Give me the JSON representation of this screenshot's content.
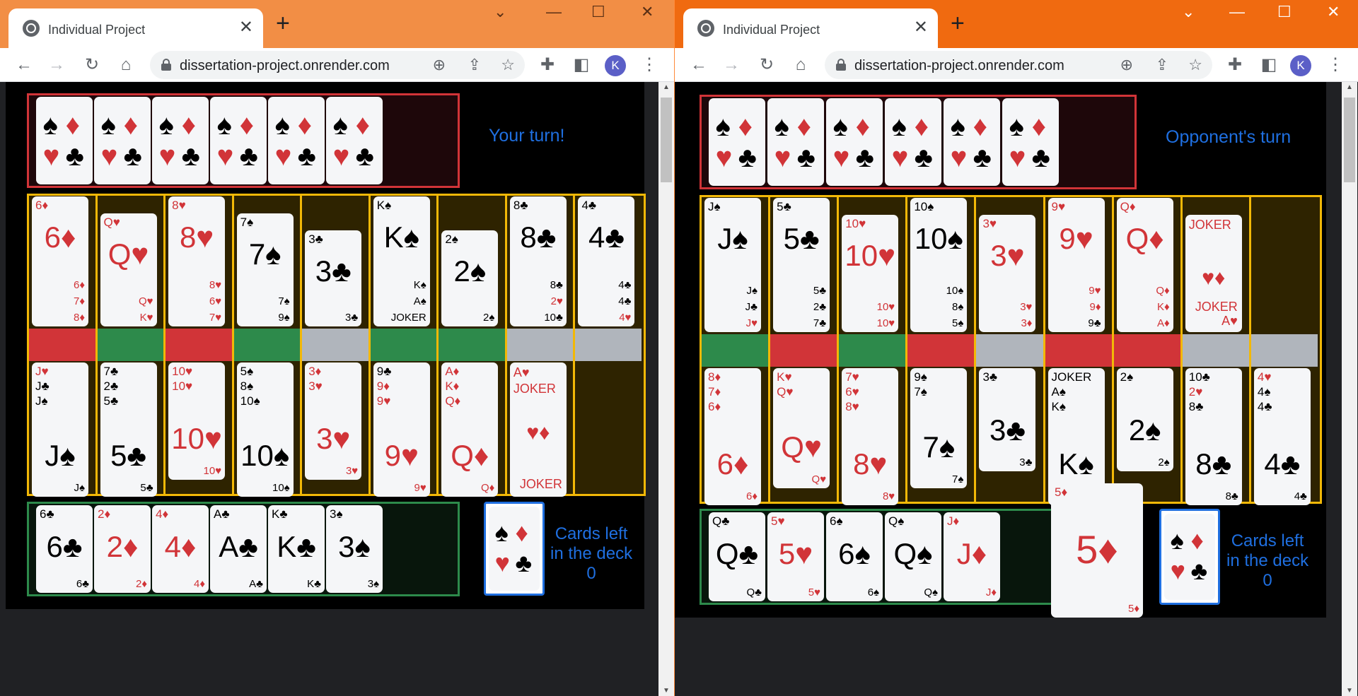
{
  "left": {
    "tab_title": "Individual Project",
    "url": "dissertation-project.onrender.com",
    "avatar": "K",
    "status": "Your turn!",
    "deck_label_1": "Cards left",
    "deck_label_2": "in the deck",
    "deck_count": "0",
    "opponent_cards": 6,
    "columns": [
      {
        "strip": "red",
        "top": [
          {
            "v": "6",
            "s": "♦",
            "c": "r",
            "tail": [
              "6♦",
              "7♦",
              "8♦"
            ]
          }
        ],
        "bottom": [
          {
            "v": "J",
            "s": "♠",
            "c": "b",
            "head": [
              "J♥",
              "J♣",
              "J♠"
            ]
          }
        ]
      },
      {
        "strip": "green",
        "top": [
          {
            "v": "Q",
            "s": "♥",
            "c": "r",
            "tail": [
              "Q♥",
              "K♥"
            ]
          }
        ],
        "bottom": [
          {
            "v": "5",
            "s": "♣",
            "c": "b",
            "head": [
              "7♣",
              "2♣",
              "5♣"
            ]
          }
        ]
      },
      {
        "strip": "red",
        "top": [
          {
            "v": "8",
            "s": "♥",
            "c": "r",
            "tail": [
              "8♥",
              "6♥",
              "7♥"
            ]
          }
        ],
        "bottom": [
          {
            "v": "10",
            "s": "♥",
            "c": "r",
            "head": [
              "10♥",
              "10♥"
            ]
          }
        ]
      },
      {
        "strip": "green",
        "top": [
          {
            "v": "7",
            "s": "♠",
            "c": "b",
            "tail": [
              "7♠",
              "9♠"
            ]
          }
        ],
        "bottom": [
          {
            "v": "10",
            "s": "♠",
            "c": "b",
            "head": [
              "5♠",
              "8♠",
              "10♠"
            ]
          }
        ]
      },
      {
        "strip": "grey",
        "top": [
          {
            "v": "3",
            "s": "♣",
            "c": "b",
            "tail": [
              "3♣"
            ]
          }
        ],
        "bottom": [
          {
            "v": "3",
            "s": "♥",
            "c": "r",
            "head": [
              "3♦",
              "3♥"
            ]
          }
        ]
      },
      {
        "strip": "green",
        "top": [
          {
            "v": "K",
            "s": "♠",
            "c": "b",
            "tail": [
              "K♠",
              "A♠",
              "JOKER"
            ]
          }
        ],
        "bottom": [
          {
            "v": "9",
            "s": "♥",
            "c": "r",
            "head": [
              "9♣",
              "9♦",
              "9♥"
            ]
          }
        ]
      },
      {
        "strip": "green",
        "top": [
          {
            "v": "2",
            "s": "♠",
            "c": "b",
            "tail": [
              "2♠"
            ]
          }
        ],
        "bottom": [
          {
            "v": "Q",
            "s": "♦",
            "c": "r",
            "head": [
              "A♦",
              "K♦",
              "Q♦"
            ]
          }
        ]
      },
      {
        "strip": "grey",
        "top": [
          {
            "v": "8",
            "s": "♣",
            "c": "b",
            "tail": [
              "8♣",
              "2♥",
              "10♣"
            ]
          }
        ],
        "bottom": [
          {
            "joker": true,
            "head": [
              "A♥",
              "JOKER"
            ],
            "foot": "JOKER"
          }
        ]
      },
      {
        "strip": "grey",
        "top": [
          {
            "v": "4",
            "s": "♣",
            "c": "b",
            "tail": [
              "4♣",
              "4♣",
              "4♥"
            ]
          }
        ],
        "bottom": []
      }
    ],
    "hand": [
      {
        "v": "6",
        "s": "♣",
        "c": "b"
      },
      {
        "v": "2",
        "s": "♦",
        "c": "r"
      },
      {
        "v": "4",
        "s": "♦",
        "c": "r"
      },
      {
        "v": "A",
        "s": "♣",
        "c": "b"
      },
      {
        "v": "K",
        "s": "♣",
        "c": "b"
      },
      {
        "v": "3",
        "s": "♠",
        "c": "b"
      }
    ]
  },
  "right": {
    "tab_title": "Individual Project",
    "url": "dissertation-project.onrender.com",
    "avatar": "K",
    "status": "Opponent's turn",
    "deck_label_1": "Cards left",
    "deck_label_2": "in the deck",
    "deck_count": "0",
    "opponent_cards": 6,
    "columns": [
      {
        "strip": "green",
        "top": [
          {
            "v": "J",
            "s": "♠",
            "c": "b",
            "tail": [
              "J♠",
              "J♣",
              "J♥"
            ]
          }
        ],
        "bottom": [
          {
            "v": "6",
            "s": "♦",
            "c": "r",
            "head": [
              "8♦",
              "7♦",
              "6♦"
            ]
          }
        ]
      },
      {
        "strip": "red",
        "top": [
          {
            "v": "5",
            "s": "♣",
            "c": "b",
            "tail": [
              "5♣",
              "2♣",
              "7♣"
            ]
          }
        ],
        "bottom": [
          {
            "v": "Q",
            "s": "♥",
            "c": "r",
            "head": [
              "K♥",
              "Q♥"
            ]
          }
        ]
      },
      {
        "strip": "green",
        "top": [
          {
            "v": "10",
            "s": "♥",
            "c": "r",
            "tail": [
              "10♥",
              "10♥"
            ]
          }
        ],
        "bottom": [
          {
            "v": "8",
            "s": "♥",
            "c": "r",
            "head": [
              "7♥",
              "6♥",
              "8♥"
            ]
          }
        ]
      },
      {
        "strip": "red",
        "top": [
          {
            "v": "10",
            "s": "♠",
            "c": "b",
            "tail": [
              "10♠",
              "8♠",
              "5♠"
            ]
          }
        ],
        "bottom": [
          {
            "v": "7",
            "s": "♠",
            "c": "b",
            "head": [
              "9♠",
              "7♠"
            ]
          }
        ]
      },
      {
        "strip": "grey",
        "top": [
          {
            "v": "3",
            "s": "♥",
            "c": "r",
            "tail": [
              "3♥",
              "3♦"
            ]
          }
        ],
        "bottom": [
          {
            "v": "3",
            "s": "♣",
            "c": "b",
            "head": [
              "3♣"
            ]
          }
        ]
      },
      {
        "strip": "red",
        "top": [
          {
            "v": "9",
            "s": "♥",
            "c": "r",
            "tail": [
              "9♥",
              "9♦",
              "9♣"
            ]
          }
        ],
        "bottom": [
          {
            "v": "K",
            "s": "♠",
            "c": "b",
            "head": [
              "JOKER",
              "A♠",
              "K♠"
            ]
          }
        ]
      },
      {
        "strip": "red",
        "top": [
          {
            "v": "Q",
            "s": "♦",
            "c": "r",
            "tail": [
              "Q♦",
              "K♦",
              "A♦"
            ]
          }
        ],
        "bottom": [
          {
            "v": "2",
            "s": "♠",
            "c": "b",
            "head": [
              "2♠"
            ]
          }
        ]
      },
      {
        "strip": "grey",
        "top": [
          {
            "joker": true,
            "head": [
              "JOKER"
            ],
            "foot": "JOKER",
            "tail2": "A♥"
          }
        ],
        "bottom": [
          {
            "v": "8",
            "s": "♣",
            "c": "b",
            "head": [
              "10♣",
              "2♥",
              "8♣"
            ]
          }
        ]
      },
      {
        "strip": "grey",
        "top": [],
        "bottom": [
          {
            "v": "4",
            "s": "♣",
            "c": "b",
            "head": [
              "4♥",
              "4♠",
              "4♣"
            ]
          }
        ]
      }
    ],
    "hand": [
      {
        "v": "Q",
        "s": "♣",
        "c": "b"
      },
      {
        "v": "5",
        "s": "♥",
        "c": "r"
      },
      {
        "v": "6",
        "s": "♠",
        "c": "b"
      },
      {
        "v": "Q",
        "s": "♠",
        "c": "b"
      },
      {
        "v": "J",
        "s": "♦",
        "c": "r"
      }
    ],
    "dragging": {
      "v": "5",
      "s": "♦",
      "c": "r"
    }
  },
  "colors": {
    "red_strip": "#d13438",
    "green_strip": "#2d8a4b",
    "grey_strip": "#b0b5bc",
    "accent": "#1f6fe0",
    "tableau_border": "#f2b807"
  }
}
